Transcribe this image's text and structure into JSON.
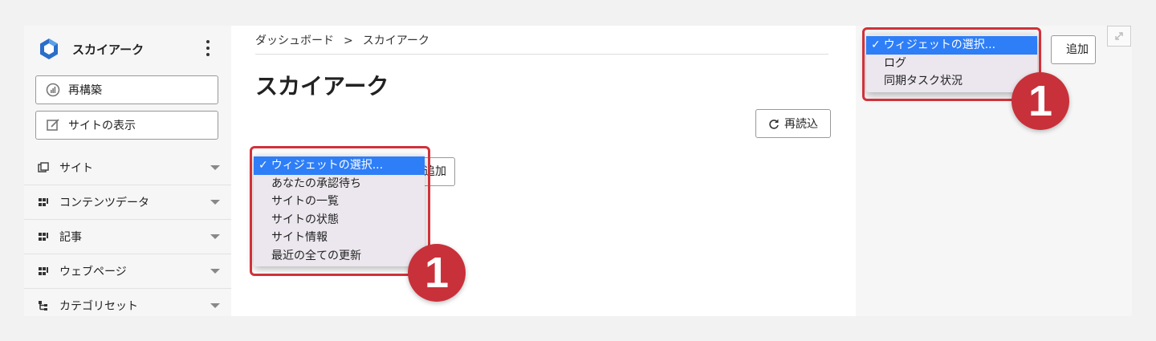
{
  "sidebar": {
    "brand_name": "スカイアーク",
    "rebuild_label": "再構築",
    "view_site_label": "サイトの表示",
    "items": [
      {
        "label": "サイト",
        "icon": "copy-icon"
      },
      {
        "label": "コンテンツデータ",
        "icon": "grid-icon"
      },
      {
        "label": "記事",
        "icon": "grid-icon"
      },
      {
        "label": "ウェブページ",
        "icon": "grid-icon"
      },
      {
        "label": "カテゴリセット",
        "icon": "hierarchy-icon"
      }
    ]
  },
  "main": {
    "breadcrumb": {
      "root": "ダッシュボード",
      "separator": ">",
      "current": "スカイアーク"
    },
    "title": "スカイアーク",
    "reload_label": "再読込",
    "add_label": "追加"
  },
  "widget_dropdown_main": {
    "selected": "ウィジェットの選択...",
    "check": "✓",
    "options": [
      "あなたの承認待ち",
      "サイトの一覧",
      "サイトの状態",
      "サイト情報",
      "最近の全ての更新"
    ]
  },
  "widget_dropdown_side": {
    "selected": "ウィジェットの選択...",
    "check": "✓",
    "options": [
      "ログ",
      "同期タスク状況"
    ]
  },
  "right_panel": {
    "add_label": "追加"
  },
  "callouts": {
    "main": "1",
    "side": "1"
  },
  "colors": {
    "highlight": "#d0323a",
    "selection": "#2e7ef7",
    "logo": "#2a6fc9"
  }
}
